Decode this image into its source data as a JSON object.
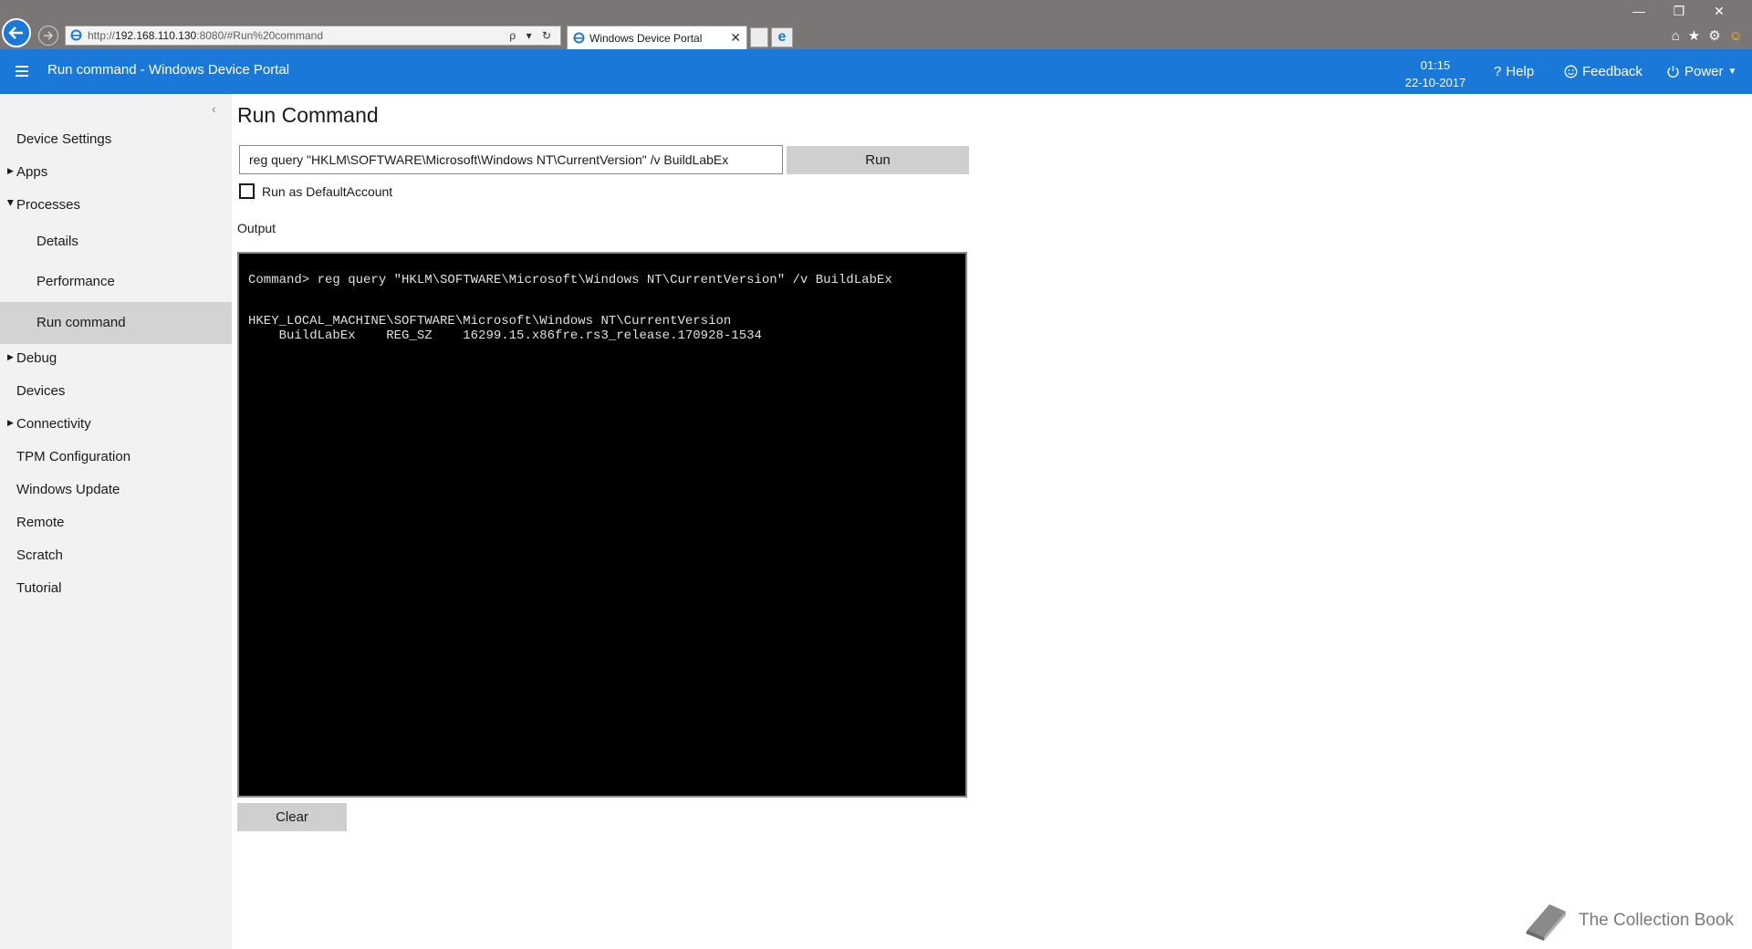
{
  "browser": {
    "url_prefix": "http://",
    "url_host": "192.168.110.130",
    "url_rest": ":8080/#Run%20command",
    "url_tools": "ρ ▾ ↻",
    "tab_title": "Windows Device Portal",
    "tab_close": "✕"
  },
  "window_controls": {
    "minimize": "—",
    "restore": "❐",
    "close": "✕"
  },
  "header": {
    "title": "Run command - Windows Device Portal",
    "time": "01:15",
    "date": "22-10-2017",
    "help": "Help",
    "feedback": "Feedback",
    "power": "Power"
  },
  "sidebar": {
    "items": [
      {
        "label": "Device Settings"
      },
      {
        "label": "Apps"
      },
      {
        "label": "Processes"
      },
      {
        "label": "Details"
      },
      {
        "label": "Performance"
      },
      {
        "label": "Run command"
      },
      {
        "label": "Debug"
      },
      {
        "label": "Devices"
      },
      {
        "label": "Connectivity"
      },
      {
        "label": "TPM Configuration"
      },
      {
        "label": "Windows Update"
      },
      {
        "label": "Remote"
      },
      {
        "label": "Scratch"
      },
      {
        "label": "Tutorial"
      }
    ]
  },
  "main": {
    "title": "Run Command",
    "command_value": "reg query \"HKLM\\SOFTWARE\\Microsoft\\Windows NT\\CurrentVersion\" /v BuildLabEx",
    "run_label": "Run",
    "checkbox_label": "Run as DefaultAccount",
    "output_label": "Output",
    "output_lines": [
      "Command> reg query \"HKLM\\SOFTWARE\\Microsoft\\Windows NT\\CurrentVersion\" /v BuildLabEx",
      "HKEY_LOCAL_MACHINE\\SOFTWARE\\Microsoft\\Windows NT\\CurrentVersion",
      "    BuildLabEx    REG_SZ    16299.15.x86fre.rs3_release.170928-1534"
    ],
    "clear_label": "Clear"
  },
  "watermark": {
    "text": "The Collection Book"
  },
  "colors": {
    "accent": "#1a78d8",
    "sidebar_bg": "#f2f2f2",
    "active_item": "#d3d3d3",
    "chrome": "#7a7676"
  }
}
